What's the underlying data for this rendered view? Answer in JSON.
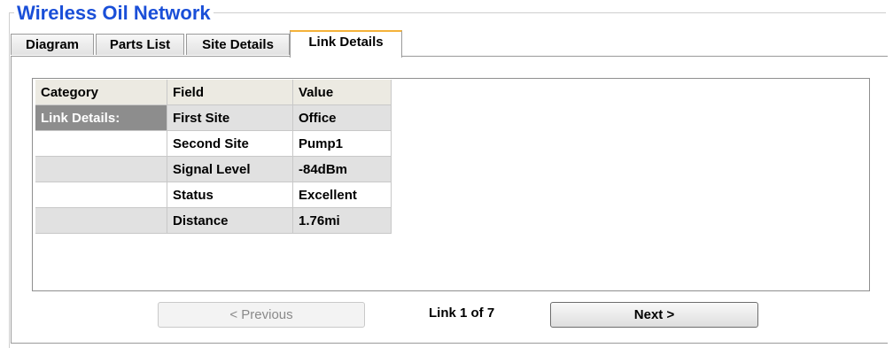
{
  "group": {
    "title": "Wireless Oil Network"
  },
  "tabs": [
    {
      "label": "Diagram"
    },
    {
      "label": "Parts List"
    },
    {
      "label": "Site Details"
    },
    {
      "label": "Link Details"
    }
  ],
  "active_tab": "Link Details",
  "grid": {
    "headers": [
      "Category",
      "Field",
      "Value"
    ],
    "rows": [
      {
        "category": "Link Details:",
        "field": "First Site",
        "value": "Office"
      },
      {
        "category": "",
        "field": "Second Site",
        "value": "Pump1"
      },
      {
        "category": "",
        "field": "Signal Level",
        "value": "-84dBm"
      },
      {
        "category": "",
        "field": "Status",
        "value": "Excellent"
      },
      {
        "category": "",
        "field": "Distance",
        "value": "1.76mi"
      }
    ]
  },
  "nav": {
    "previous_label": "< Previous",
    "counter": "Link 1 of 7",
    "next_label": "Next >"
  }
}
